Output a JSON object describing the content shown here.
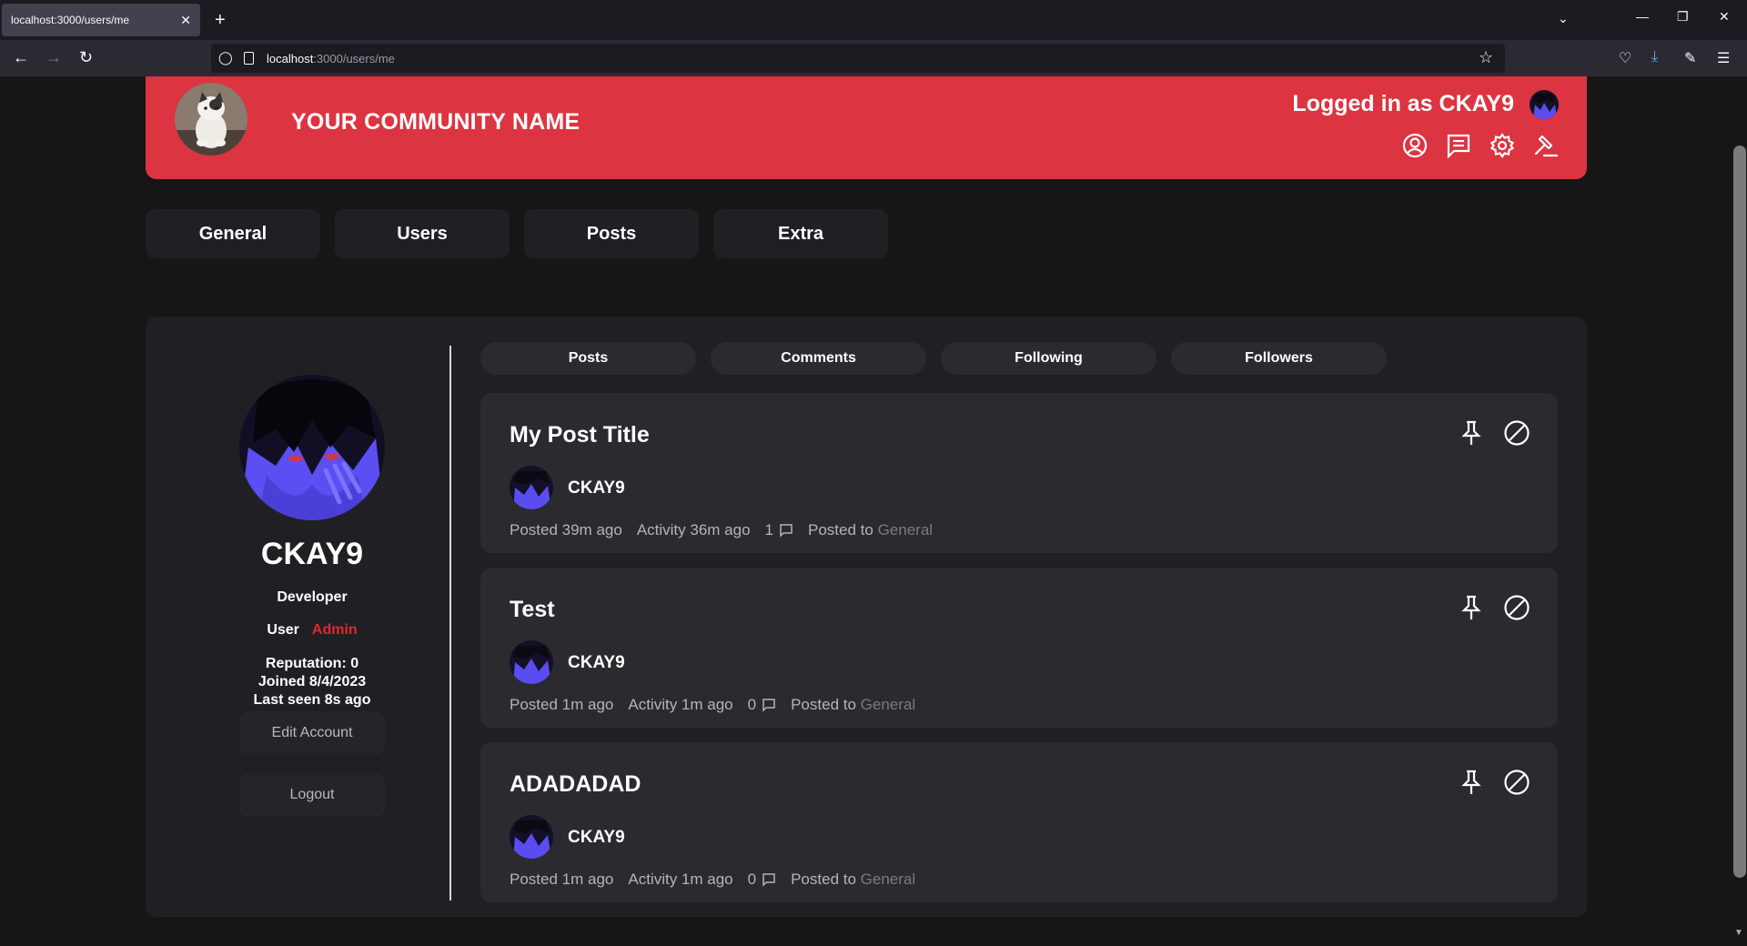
{
  "browser": {
    "tab_title": "localhost:3000/users/me",
    "tab_close": "✕",
    "new_tab": "+",
    "url_host": "localhost",
    "url_path": ":3000/users/me"
  },
  "header": {
    "community_name": "YOUR COMMUNITY NAME",
    "logged_in_text": "Logged in as CKAY9"
  },
  "nav": {
    "items": [
      "General",
      "Users",
      "Posts",
      "Extra"
    ]
  },
  "profile": {
    "username": "CKAY9",
    "title": "Developer",
    "groups": [
      "User",
      "Admin"
    ],
    "reputation": "Reputation: 0",
    "joined": "Joined 8/4/2023",
    "last_seen": "Last seen 8s ago",
    "edit_account_label": "Edit Account",
    "logout_label": "Logout"
  },
  "tabs": [
    "Posts",
    "Comments",
    "Following",
    "Followers"
  ],
  "posts": [
    {
      "title": "My Post Title",
      "author": "CKAY9",
      "posted": "Posted 39m ago",
      "activity": "Activity 36m ago",
      "comments": "1",
      "posted_to_label": "Posted to",
      "forum": "General"
    },
    {
      "title": "Test",
      "author": "CKAY9",
      "posted": "Posted 1m ago",
      "activity": "Activity 1m ago",
      "comments": "0",
      "posted_to_label": "Posted to",
      "forum": "General"
    },
    {
      "title": "ADADADAD",
      "author": "CKAY9",
      "posted": "Posted 1m ago",
      "activity": "Activity 1m ago",
      "comments": "0",
      "posted_to_label": "Posted to",
      "forum": "General"
    }
  ],
  "colors": {
    "banner": "#dc3440",
    "admin": "#e0262f",
    "background": "#161616",
    "card": "#202024"
  },
  "icons": {
    "banner": [
      "profile-icon",
      "messages-icon",
      "settings-icon",
      "moderation-gavel-icon"
    ],
    "post_actions": [
      "pin-icon",
      "ban-icon"
    ]
  }
}
